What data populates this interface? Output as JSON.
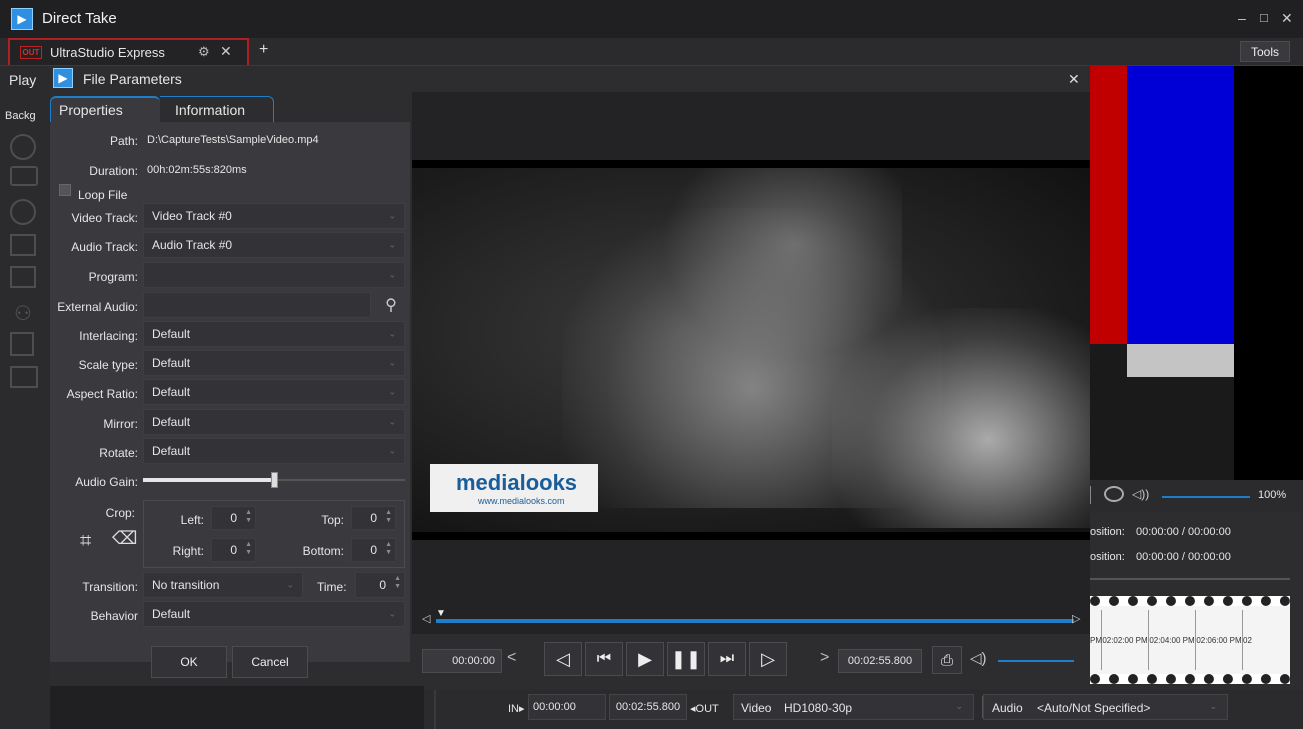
{
  "app": {
    "title": "Direct Take",
    "window_controls": [
      "–",
      "□",
      "✕"
    ]
  },
  "tabs": [
    {
      "badge": "OUT",
      "label": "UltraStudio Express"
    }
  ],
  "tools_label": "Tools",
  "left_panel": {
    "play_label": "Play",
    "background_label": "Backg"
  },
  "dialog": {
    "title": "File Parameters",
    "close": "✕",
    "tabs": [
      "Properties",
      "Information"
    ],
    "path_label": "Path:",
    "path_value": "D:\\CaptureTests\\SampleVideo.mp4",
    "duration_label": "Duration:",
    "duration_value": "00h:02m:55s:820ms",
    "loop_label": "Loop File",
    "video_track_label": "Video Track:",
    "video_track_value": "Video Track #0",
    "audio_track_label": "Audio Track:",
    "audio_track_value": "Audio Track #0",
    "program_label": "Program:",
    "program_value": "",
    "external_audio_label": "External Audio:",
    "external_audio_value": "",
    "interlacing_label": "Interlacing:",
    "interlacing_value": "Default",
    "scale_label": "Scale type:",
    "scale_value": "Default",
    "aspect_label": "Aspect Ratio:",
    "aspect_value": "Default",
    "mirror_label": "Mirror:",
    "mirror_value": "Default",
    "rotate_label": "Rotate:",
    "rotate_value": "Default",
    "audio_gain_label": "Audio Gain:",
    "audio_gain_level": 0.5,
    "crop_label": "Crop:",
    "crop_left_label": "Left:",
    "crop_left_value": "0",
    "crop_top_label": "Top:",
    "crop_top_value": "0",
    "crop_right_label": "Right:",
    "crop_right_value": "0",
    "crop_bottom_label": "Bottom:",
    "crop_bottom_value": "0",
    "transition_label": "Transition:",
    "transition_value": "No transition",
    "time_label": "Time:",
    "time_value": "0",
    "behavior_label": "Behavior",
    "behavior_value": "Default",
    "ok_label": "OK",
    "cancel_label": "Cancel"
  },
  "preview": {
    "logo_text": "medialooks",
    "logo_url": "www.medialooks.com",
    "time_in": "00:00:00",
    "time_out": "00:02:55.800"
  },
  "bottom_bar": {
    "in_label": "IN▸",
    "in_value": "00:00:00",
    "out_value": "00:02:55.800",
    "out_label": "◂OUT",
    "video_label": "Video",
    "video_format": "HD1080-30p",
    "audio_label": "Audio",
    "audio_format": "<Auto/Not Specified>"
  },
  "right_panel": {
    "volume_percent": "100%",
    "position1_label": "osition:",
    "position1_value": "00:00:00 / 00:00:00",
    "position2_label": "osition:",
    "position2_value": "00:00:00 / 00:00:00",
    "film_times": [
      "PM",
      "02:02:00 PM",
      "02:04:00 PM",
      "02:06:00 PM",
      "02"
    ]
  },
  "colors": {
    "accent": "#1e7fc8",
    "bar_red": "#c00000",
    "bar_blue": "#0000d6",
    "bar_gray": "#c4c4c4"
  }
}
